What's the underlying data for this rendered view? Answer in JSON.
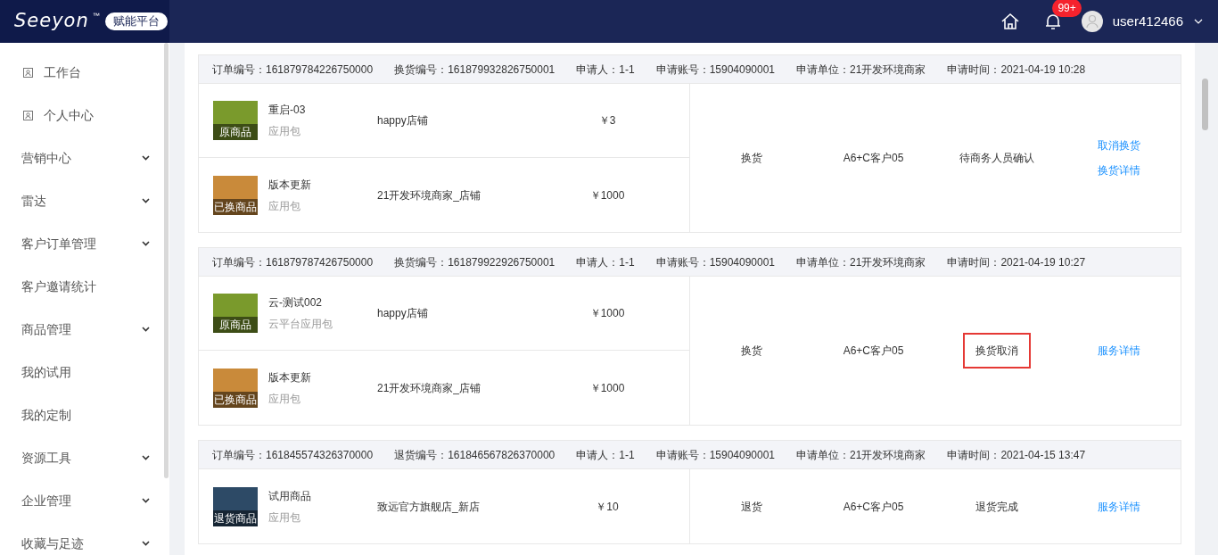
{
  "header": {
    "logo": "Seeyon",
    "logo_mark": "™",
    "platform_badge": "赋能平台",
    "notification_count": "99+",
    "username": "user412466"
  },
  "sidebar": {
    "items": [
      {
        "label": "工作台",
        "kind": "icon"
      },
      {
        "label": "个人中心",
        "kind": "icon"
      },
      {
        "label": "营销中心",
        "kind": "group"
      },
      {
        "label": "雷达",
        "kind": "group"
      },
      {
        "label": "客户订单管理",
        "kind": "group"
      },
      {
        "label": "客户邀请统计",
        "kind": "plain"
      },
      {
        "label": "商品管理",
        "kind": "group"
      },
      {
        "label": "我的试用",
        "kind": "plain"
      },
      {
        "label": "我的定制",
        "kind": "plain"
      },
      {
        "label": "资源工具",
        "kind": "group"
      },
      {
        "label": "企业管理",
        "kind": "group"
      },
      {
        "label": "收藏与足迹",
        "kind": "group"
      }
    ]
  },
  "orders": [
    {
      "meta": [
        "订单编号：161879784226750000",
        "换货编号：161879932826750001",
        "申请人：1-1",
        "申请账号：15904090001",
        "申请单位：21开发环境商家",
        "申请时间：2021-04-19 10:28"
      ],
      "products": [
        {
          "tag": "原商品",
          "name": "重启-03",
          "category": "应用包",
          "store": "happy店铺",
          "price": "￥3"
        },
        {
          "tag": "已换商品",
          "name": "版本更新",
          "category": "应用包",
          "store": "21开发环境商家_店铺",
          "price": "￥1000"
        }
      ],
      "type": "换货",
      "customer": "A6+C客户05",
      "status": "待商务人员确认",
      "status_highlighted": false,
      "actions": [
        "取消换货",
        "换货详情"
      ]
    },
    {
      "meta": [
        "订单编号：161879787426750000",
        "换货编号：161879922926750001",
        "申请人：1-1",
        "申请账号：15904090001",
        "申请单位：21开发环境商家",
        "申请时间：2021-04-19 10:27"
      ],
      "products": [
        {
          "tag": "原商品",
          "name": "云-测试002",
          "category": "云平台应用包",
          "store": "happy店铺",
          "price": "￥1000"
        },
        {
          "tag": "已换商品",
          "name": "版本更新",
          "category": "应用包",
          "store": "21开发环境商家_店铺",
          "price": "￥1000"
        }
      ],
      "type": "换货",
      "customer": "A6+C客户05",
      "status": "换货取消",
      "status_highlighted": true,
      "actions": [
        "服务详情"
      ]
    },
    {
      "meta": [
        "订单编号：161845574326370000",
        "退货编号：161846567826370000",
        "申请人：1-1",
        "申请账号：15904090001",
        "申请单位：21开发环境商家",
        "申请时间：2021-04-15 13:47"
      ],
      "products": [
        {
          "tag": "退货商品",
          "name": "试用商品",
          "category": "应用包",
          "store": "致远官方旗舰店_新店",
          "price": "￥10"
        }
      ],
      "type": "退货",
      "customer": "A6+C客户05",
      "status": "退货完成",
      "status_highlighted": false,
      "actions": [
        "服务详情"
      ]
    }
  ]
}
